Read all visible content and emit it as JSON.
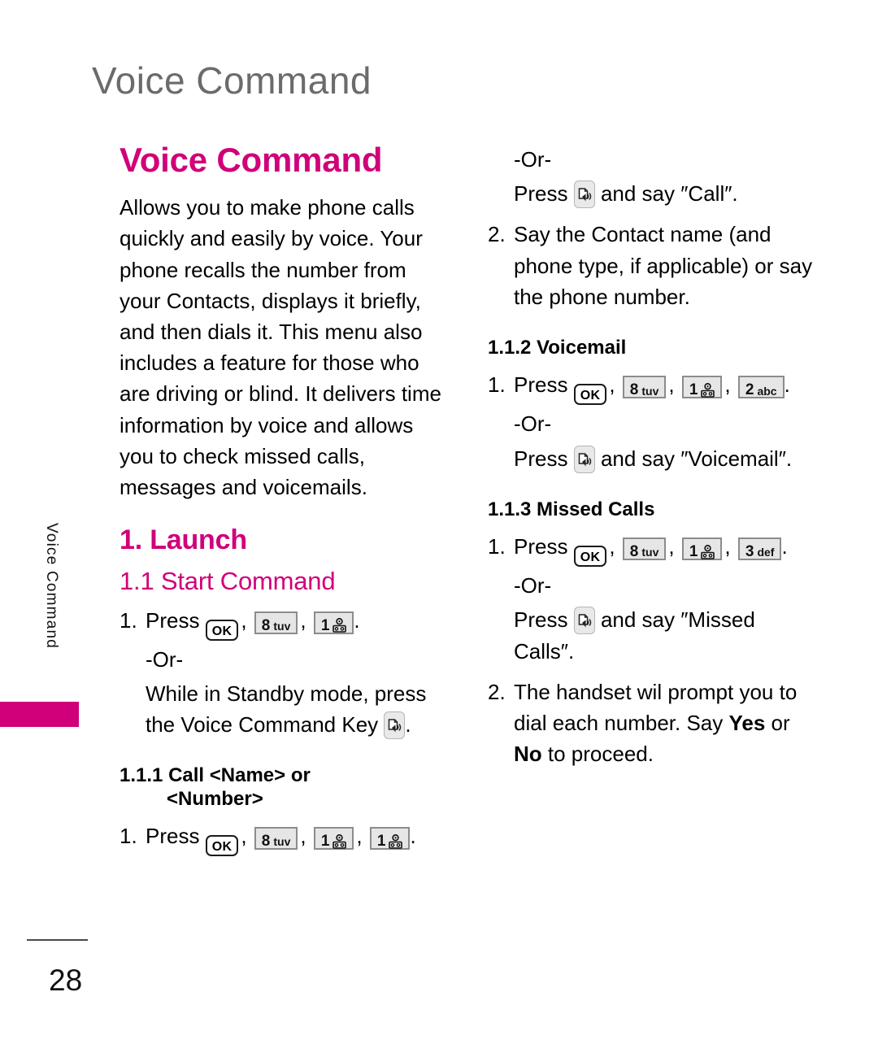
{
  "page": {
    "running_header": "Voice Command",
    "side_tab_label": "Voice Command",
    "page_number": "28",
    "accent_color": "#d0007a",
    "header_color": "#6b6b6b"
  },
  "keys": {
    "ok": "OK",
    "k8_digit": "8",
    "k8_letters": "tuv",
    "k1_digit": "1",
    "k2_digit": "2",
    "k2_letters": "abc",
    "k3_digit": "3",
    "k3_letters": "def",
    "voicemail_icon_name": "voicemail-icon",
    "voice_command_key_icon_name": "voice-command-key-icon"
  },
  "left_column": {
    "title": "Voice Command",
    "intro": "Allows you to make phone calls quickly and easily by voice. Your phone recalls the number from your Contacts, displays it briefly, and then dials it. This menu also includes a feature for those who are driving or blind. It delivers time information by voice and allows you to check missed calls, messages and voicemails.",
    "section_launch": "1. Launch",
    "section_start_command": "1.1 Start Command",
    "step1_num": "1.",
    "step1_press": "Press",
    "step1_period": ".",
    "or_label": "-Or-",
    "standby_text_a": "While in Standby mode, press the Voice Command Key",
    "standby_text_b": ".",
    "section_111_prefix": "1.1.1",
    "section_111_line1": "Call <Name> or",
    "section_111_line2": "<Number>",
    "step111_num": "1.",
    "step111_press": "Press",
    "step111_period": "."
  },
  "right_column": {
    "or_label_1": "-Or-",
    "press_call_a": "Press",
    "press_call_b": "and say ″Call″.",
    "step2_num": "2.",
    "step2_text": "Say the Contact name (and phone type, if applicable) or say the phone number.",
    "section_112": "1.1.2 Voicemail",
    "step112_num": "1.",
    "step112_press": "Press",
    "step112_period": ".",
    "or_label_2": "-Or-",
    "press_voicemail_a": "Press",
    "press_voicemail_b": "and say ″Voicemail″.",
    "section_113": "1.1.3 Missed Calls",
    "step113_num": "1.",
    "step113_press": "Press",
    "step113_period": ".",
    "or_label_3": "-Or-",
    "press_missed_a": "Press",
    "press_missed_b": "and say ″Missed Calls″.",
    "final_step_num": "2.",
    "final_step_a": "The handset wil prompt you to dial each number. Say ",
    "final_step_yes": "Yes",
    "final_step_b": " or ",
    "final_step_no": "No",
    "final_step_c": " to proceed."
  }
}
